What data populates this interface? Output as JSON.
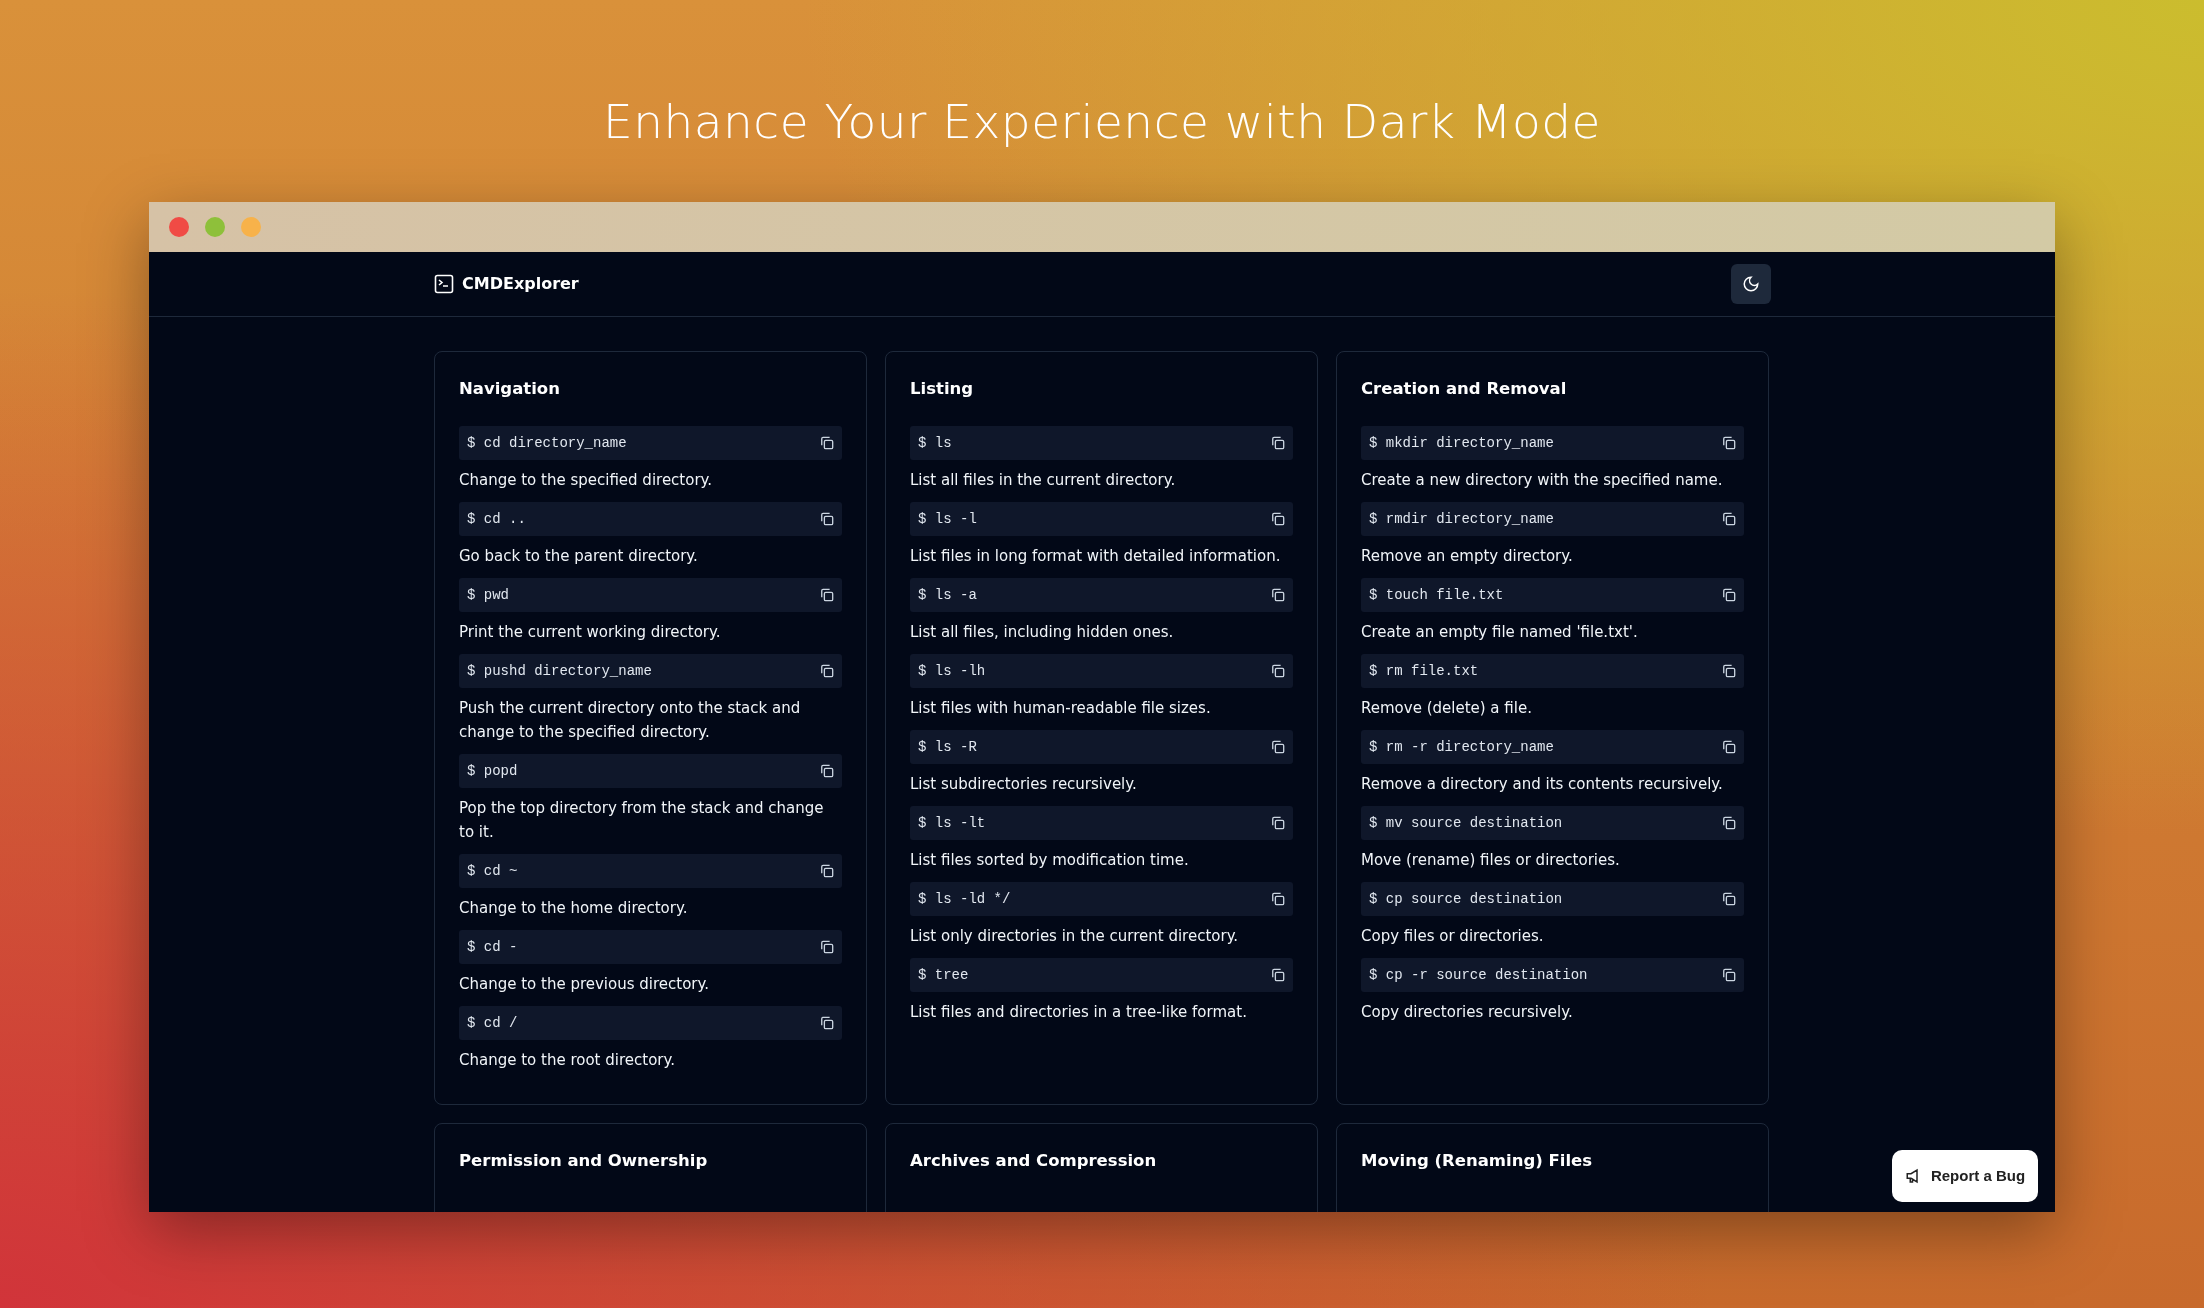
{
  "page_title": "Enhance Your Experience with Dark Mode",
  "window": {
    "controls": [
      {
        "color": "#f04b45"
      },
      {
        "color": "#8ec03a"
      },
      {
        "color": "#f7b24a"
      }
    ]
  },
  "navbar": {
    "brand": "CMDExplorer"
  },
  "cards": [
    {
      "title": "Navigation",
      "commands": [
        {
          "command": "$ cd directory_name",
          "description": "Change to the specified directory."
        },
        {
          "command": "$ cd ..",
          "description": "Go back to the parent directory."
        },
        {
          "command": "$ pwd",
          "description": "Print the current working directory."
        },
        {
          "command": "$ pushd directory_name",
          "description": "Push the current directory onto the stack and change to the specified directory."
        },
        {
          "command": "$ popd",
          "description": "Pop the top directory from the stack and change to it."
        },
        {
          "command": "$ cd ~",
          "description": "Change to the home directory."
        },
        {
          "command": "$ cd -",
          "description": "Change to the previous directory."
        },
        {
          "command": "$ cd /",
          "description": "Change to the root directory."
        }
      ]
    },
    {
      "title": "Listing",
      "commands": [
        {
          "command": "$ ls",
          "description": "List all files in the current directory."
        },
        {
          "command": "$ ls -l",
          "description": "List files in long format with detailed information."
        },
        {
          "command": "$ ls -a",
          "description": "List all files, including hidden ones."
        },
        {
          "command": "$ ls -lh",
          "description": "List files with human-readable file sizes."
        },
        {
          "command": "$ ls -R",
          "description": "List subdirectories recursively."
        },
        {
          "command": "$ ls -lt",
          "description": "List files sorted by modification time."
        },
        {
          "command": "$ ls -ld */",
          "description": "List only directories in the current directory."
        },
        {
          "command": "$ tree",
          "description": "List files and directories in a tree-like format."
        }
      ]
    },
    {
      "title": "Creation and Removal",
      "commands": [
        {
          "command": "$ mkdir directory_name",
          "description": "Create a new directory with the specified name."
        },
        {
          "command": "$ rmdir directory_name",
          "description": "Remove an empty directory."
        },
        {
          "command": "$ touch file.txt",
          "description": "Create an empty file named 'file.txt'."
        },
        {
          "command": "$ rm file.txt",
          "description": "Remove (delete) a file."
        },
        {
          "command": "$ rm -r directory_name",
          "description": "Remove a directory and its contents recursively."
        },
        {
          "command": "$ mv source destination",
          "description": "Move (rename) files or directories."
        },
        {
          "command": "$ cp source destination",
          "description": "Copy files or directories."
        },
        {
          "command": "$ cp -r source destination",
          "description": "Copy directories recursively."
        }
      ]
    },
    {
      "title": "Permission and Ownership"
    },
    {
      "title": "Archives and Compression"
    },
    {
      "title": "Moving (Renaming) Files"
    }
  ],
  "report_button": {
    "label": "Report a Bug"
  }
}
